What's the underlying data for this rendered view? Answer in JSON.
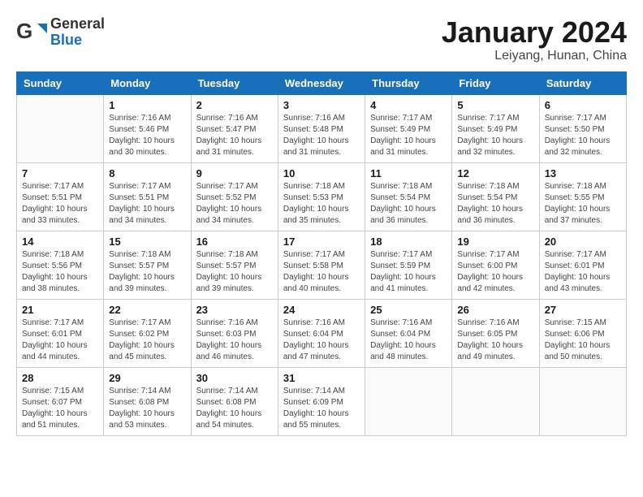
{
  "header": {
    "logo_general": "General",
    "logo_blue": "Blue",
    "month": "January 2024",
    "location": "Leiyang, Hunan, China"
  },
  "weekdays": [
    "Sunday",
    "Monday",
    "Tuesday",
    "Wednesday",
    "Thursday",
    "Friday",
    "Saturday"
  ],
  "weeks": [
    [
      {
        "day": "",
        "empty": true
      },
      {
        "day": "1",
        "sunrise": "7:16 AM",
        "sunset": "5:46 PM",
        "daylight": "10 hours and 30 minutes."
      },
      {
        "day": "2",
        "sunrise": "7:16 AM",
        "sunset": "5:47 PM",
        "daylight": "10 hours and 31 minutes."
      },
      {
        "day": "3",
        "sunrise": "7:16 AM",
        "sunset": "5:48 PM",
        "daylight": "10 hours and 31 minutes."
      },
      {
        "day": "4",
        "sunrise": "7:17 AM",
        "sunset": "5:49 PM",
        "daylight": "10 hours and 31 minutes."
      },
      {
        "day": "5",
        "sunrise": "7:17 AM",
        "sunset": "5:49 PM",
        "daylight": "10 hours and 32 minutes."
      },
      {
        "day": "6",
        "sunrise": "7:17 AM",
        "sunset": "5:50 PM",
        "daylight": "10 hours and 32 minutes."
      }
    ],
    [
      {
        "day": "7",
        "sunrise": "7:17 AM",
        "sunset": "5:51 PM",
        "daylight": "10 hours and 33 minutes."
      },
      {
        "day": "8",
        "sunrise": "7:17 AM",
        "sunset": "5:51 PM",
        "daylight": "10 hours and 34 minutes."
      },
      {
        "day": "9",
        "sunrise": "7:17 AM",
        "sunset": "5:52 PM",
        "daylight": "10 hours and 34 minutes."
      },
      {
        "day": "10",
        "sunrise": "7:18 AM",
        "sunset": "5:53 PM",
        "daylight": "10 hours and 35 minutes."
      },
      {
        "day": "11",
        "sunrise": "7:18 AM",
        "sunset": "5:54 PM",
        "daylight": "10 hours and 36 minutes."
      },
      {
        "day": "12",
        "sunrise": "7:18 AM",
        "sunset": "5:54 PM",
        "daylight": "10 hours and 36 minutes."
      },
      {
        "day": "13",
        "sunrise": "7:18 AM",
        "sunset": "5:55 PM",
        "daylight": "10 hours and 37 minutes."
      }
    ],
    [
      {
        "day": "14",
        "sunrise": "7:18 AM",
        "sunset": "5:56 PM",
        "daylight": "10 hours and 38 minutes."
      },
      {
        "day": "15",
        "sunrise": "7:18 AM",
        "sunset": "5:57 PM",
        "daylight": "10 hours and 39 minutes."
      },
      {
        "day": "16",
        "sunrise": "7:18 AM",
        "sunset": "5:57 PM",
        "daylight": "10 hours and 39 minutes."
      },
      {
        "day": "17",
        "sunrise": "7:17 AM",
        "sunset": "5:58 PM",
        "daylight": "10 hours and 40 minutes."
      },
      {
        "day": "18",
        "sunrise": "7:17 AM",
        "sunset": "5:59 PM",
        "daylight": "10 hours and 41 minutes."
      },
      {
        "day": "19",
        "sunrise": "7:17 AM",
        "sunset": "6:00 PM",
        "daylight": "10 hours and 42 minutes."
      },
      {
        "day": "20",
        "sunrise": "7:17 AM",
        "sunset": "6:01 PM",
        "daylight": "10 hours and 43 minutes."
      }
    ],
    [
      {
        "day": "21",
        "sunrise": "7:17 AM",
        "sunset": "6:01 PM",
        "daylight": "10 hours and 44 minutes."
      },
      {
        "day": "22",
        "sunrise": "7:17 AM",
        "sunset": "6:02 PM",
        "daylight": "10 hours and 45 minutes."
      },
      {
        "day": "23",
        "sunrise": "7:16 AM",
        "sunset": "6:03 PM",
        "daylight": "10 hours and 46 minutes."
      },
      {
        "day": "24",
        "sunrise": "7:16 AM",
        "sunset": "6:04 PM",
        "daylight": "10 hours and 47 minutes."
      },
      {
        "day": "25",
        "sunrise": "7:16 AM",
        "sunset": "6:04 PM",
        "daylight": "10 hours and 48 minutes."
      },
      {
        "day": "26",
        "sunrise": "7:16 AM",
        "sunset": "6:05 PM",
        "daylight": "10 hours and 49 minutes."
      },
      {
        "day": "27",
        "sunrise": "7:15 AM",
        "sunset": "6:06 PM",
        "daylight": "10 hours and 50 minutes."
      }
    ],
    [
      {
        "day": "28",
        "sunrise": "7:15 AM",
        "sunset": "6:07 PM",
        "daylight": "10 hours and 51 minutes."
      },
      {
        "day": "29",
        "sunrise": "7:14 AM",
        "sunset": "6:08 PM",
        "daylight": "10 hours and 53 minutes."
      },
      {
        "day": "30",
        "sunrise": "7:14 AM",
        "sunset": "6:08 PM",
        "daylight": "10 hours and 54 minutes."
      },
      {
        "day": "31",
        "sunrise": "7:14 AM",
        "sunset": "6:09 PM",
        "daylight": "10 hours and 55 minutes."
      },
      {
        "day": "",
        "empty": true
      },
      {
        "day": "",
        "empty": true
      },
      {
        "day": "",
        "empty": true
      }
    ]
  ]
}
